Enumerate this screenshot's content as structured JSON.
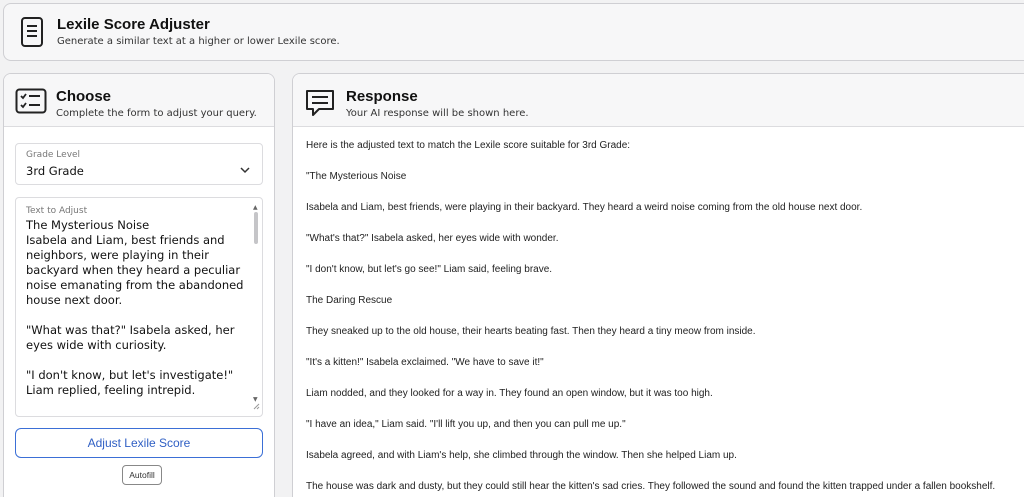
{
  "app": {
    "title": "Lexile Score Adjuster",
    "subtitle": "Generate a similar text at a higher or lower Lexile score.",
    "icon": "document-icon"
  },
  "choose": {
    "title": "Choose",
    "subtitle": "Complete the form to adjust your query.",
    "icon": "checklist-icon",
    "grade_level": {
      "label": "Grade Level",
      "value": "3rd Grade"
    },
    "text_to_adjust": {
      "label": "Text to Adjust",
      "value": "The Mysterious Noise\nIsabela and Liam, best friends and neighbors, were playing in their backyard when they heard a peculiar noise emanating from the abandoned house next door.\n\n\"What was that?\" Isabela asked, her eyes wide with curiosity.\n\n\"I don't know, but let's investigate!\" Liam replied, feeling intrepid.\n\nThe Daring Rescue"
    },
    "submit_label": "Adjust Lexile Score",
    "autofill_label": "Autofill"
  },
  "response": {
    "title": "Response",
    "subtitle": "Your AI response will be shown here.",
    "icon": "chat-icon",
    "paragraphs": [
      "Here is the adjusted text to match the Lexile score suitable for 3rd Grade:",
      "\"The Mysterious Noise",
      "Isabela and Liam, best friends, were playing in their backyard. They heard a weird noise coming from the old house next door.",
      "\"What's that?\" Isabela asked, her eyes wide with wonder.",
      "\"I don't know, but let's go see!\" Liam said, feeling brave.",
      "The Daring Rescue",
      "They sneaked up to the old house, their hearts beating fast. Then they heard a tiny meow from inside.",
      "\"It's a kitten!\" Isabela exclaimed. \"We have to save it!\"",
      "Liam nodded, and they looked for a way in. They found an open window, but it was too high.",
      "\"I have an idea,\" Liam said. \"I'll lift you up, and then you can pull me up.\"",
      "Isabela agreed, and with Liam's help, she climbed through the window. Then she helped Liam up.",
      "The house was dark and dusty, but they could still hear the kitten's sad cries. They followed the sound and found the kitten trapped under a fallen bookshelf."
    ]
  },
  "colors": {
    "accent": "#2f5fc4",
    "border": "#cfcfd3",
    "panel_header": "#f7f7f8",
    "background": "#f2f2f3"
  }
}
